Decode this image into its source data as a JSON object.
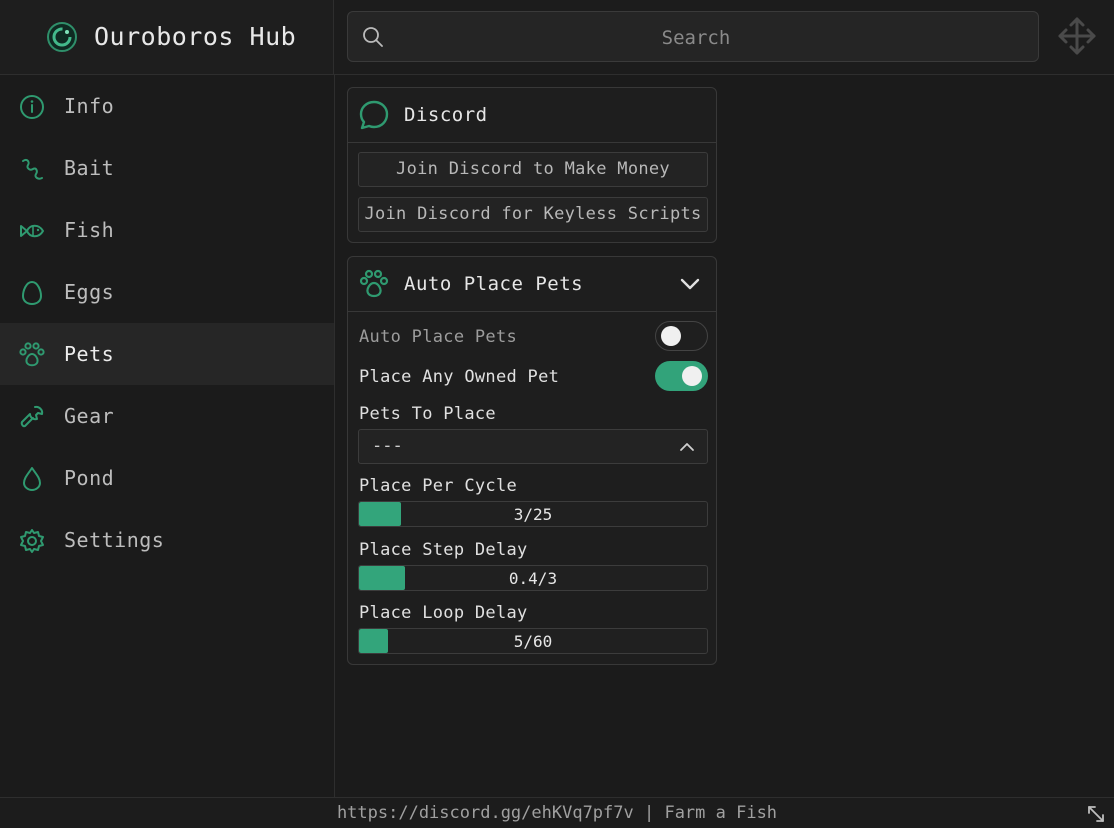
{
  "app": {
    "title": "Ouroboros Hub"
  },
  "search": {
    "placeholder": "Search"
  },
  "sidebar": {
    "items": [
      {
        "label": "Info",
        "icon": "info-icon"
      },
      {
        "label": "Bait",
        "icon": "worm-icon"
      },
      {
        "label": "Fish",
        "icon": "fish-icon"
      },
      {
        "label": "Eggs",
        "icon": "egg-icon"
      },
      {
        "label": "Pets",
        "icon": "paw-icon",
        "active": true
      },
      {
        "label": "Gear",
        "icon": "wrench-icon"
      },
      {
        "label": "Pond",
        "icon": "droplet-icon"
      },
      {
        "label": "Settings",
        "icon": "gear-icon"
      }
    ]
  },
  "discord_card": {
    "title": "Discord",
    "buttons": [
      "Join Discord to Make Money",
      "Join Discord for Keyless Scripts"
    ]
  },
  "pets_card": {
    "title": "Auto Place Pets",
    "toggles": [
      {
        "label": "Auto Place Pets",
        "on": false
      },
      {
        "label": "Place Any Owned Pet",
        "on": true
      }
    ],
    "dropdown": {
      "label": "Pets To Place",
      "value": "---"
    },
    "sliders": [
      {
        "label": "Place Per Cycle",
        "value": 3,
        "max": 25,
        "text": "3/25"
      },
      {
        "label": "Place Step Delay",
        "value": 0.4,
        "max": 3,
        "text": "0.4/3"
      },
      {
        "label": "Place Loop Delay",
        "value": 5,
        "max": 60,
        "text": "5/60"
      }
    ]
  },
  "footer": {
    "text": "https://discord.gg/ehKVq7pf7v | Farm a Fish"
  },
  "colors": {
    "accent": "#33a57b",
    "background": "#1b1b1b"
  }
}
